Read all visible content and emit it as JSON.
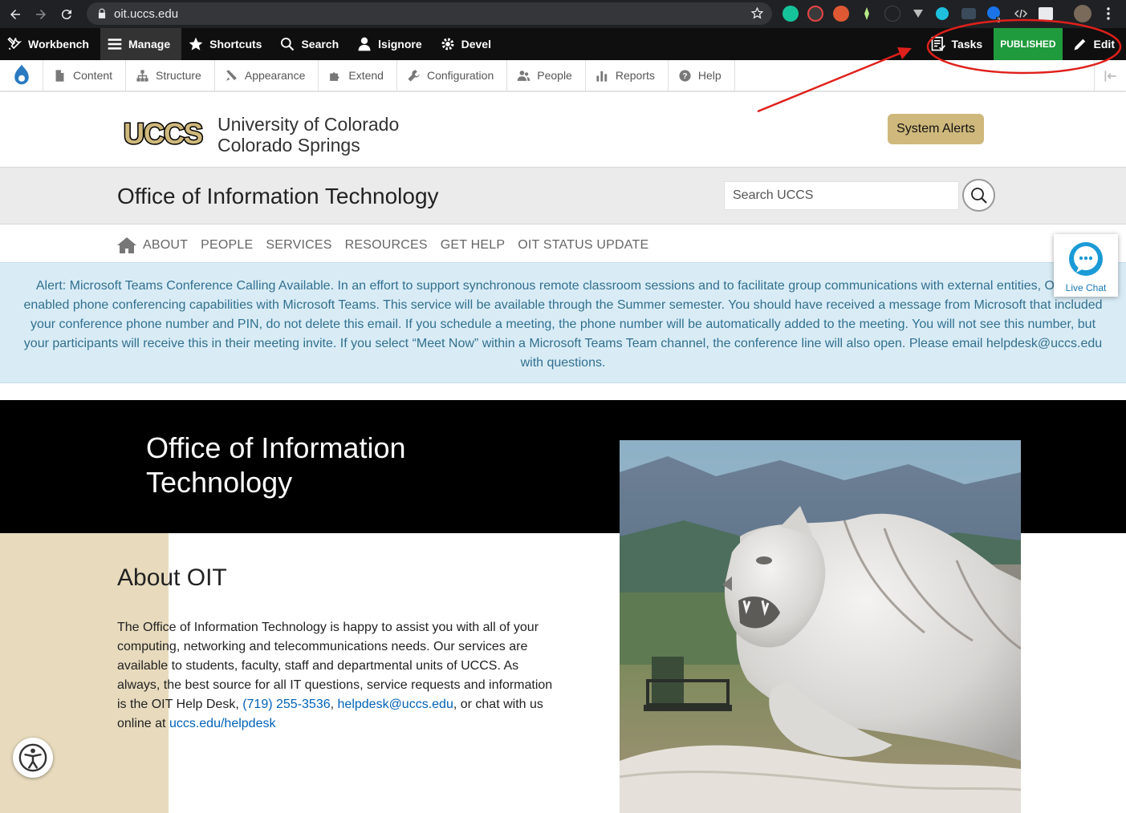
{
  "browser": {
    "url": "oit.uccs.edu",
    "extension_badge": "3"
  },
  "toolbar": {
    "items": [
      {
        "label": "Workbench",
        "icon": "tools-icon"
      },
      {
        "label": "Manage",
        "icon": "menu-icon"
      },
      {
        "label": "Shortcuts",
        "icon": "star-icon"
      },
      {
        "label": "Search",
        "icon": "search-icon"
      },
      {
        "label": "lsignore",
        "icon": "user-icon"
      },
      {
        "label": "Devel",
        "icon": "gear-icon"
      }
    ],
    "tasks_label": "Tasks",
    "status_label": "PUBLISHED",
    "edit_label": "Edit"
  },
  "admin_tray": {
    "items": [
      {
        "label": "Content",
        "icon": "file-icon"
      },
      {
        "label": "Structure",
        "icon": "sitemap-icon"
      },
      {
        "label": "Appearance",
        "icon": "brush-icon"
      },
      {
        "label": "Extend",
        "icon": "puzzle-icon"
      },
      {
        "label": "Configuration",
        "icon": "wrench-icon"
      },
      {
        "label": "People",
        "icon": "people-icon"
      },
      {
        "label": "Reports",
        "icon": "bar-chart-icon"
      },
      {
        "label": "Help",
        "icon": "help-icon"
      }
    ]
  },
  "header": {
    "logo_text": "UCCS",
    "university_line1": "University of Colorado",
    "university_line2": "Colorado Springs",
    "system_alerts": "System Alerts"
  },
  "site": {
    "title": "Office of Information Technology",
    "search_placeholder": "Search UCCS"
  },
  "nav": {
    "links": [
      "ABOUT",
      "PEOPLE",
      "SERVICES",
      "RESOURCES",
      "GET HELP",
      "OIT STATUS UPDATE"
    ]
  },
  "live_chat": "Live Chat",
  "alert": {
    "text": "Alert: Microsoft Teams Conference Calling Available. In an effort to support synchronous remote classroom sessions and to facilitate group communications with external entities, OIT has enabled phone conferencing capabilities with Microsoft Teams. This service will be available through the Summer semester. You should have received a message from Microsoft that included your conference phone number and PIN, do not delete this email. If you schedule a meeting, the phone number will be automatically added to the meeting. You will not see this number, but your participants will receive this in their meeting invite. If you select “Meet Now” within a Microsoft Teams Team channel, the conference line will also open. Please email helpdesk@uccs.edu with questions."
  },
  "hero": {
    "title": "Office of Information Technology"
  },
  "about": {
    "heading": "About OIT",
    "intro": "The Office of Information Technology is happy to assist you with all of your computing, networking and telecommunications needs. Our services are available to students, faculty, staff and departmental units of UCCS. As always, the best source for all IT questions, service requests and information is the OIT Help Desk, ",
    "phone": "(719) 255-3536",
    "sep": ", ",
    "email": "helpdesk@uccs.edu",
    "mid": ", or chat with us online at ",
    "link": "uccs.edu/helpdesk"
  },
  "colors": {
    "toolbar_bg": "#0f0f0f",
    "published_green": "#1f9b3d",
    "uccs_gold": "#cfb87c",
    "alert_bg": "#d9ecf6",
    "alert_text": "#31708f",
    "link_blue": "#0062b8",
    "annotation_red": "#e0201b"
  }
}
